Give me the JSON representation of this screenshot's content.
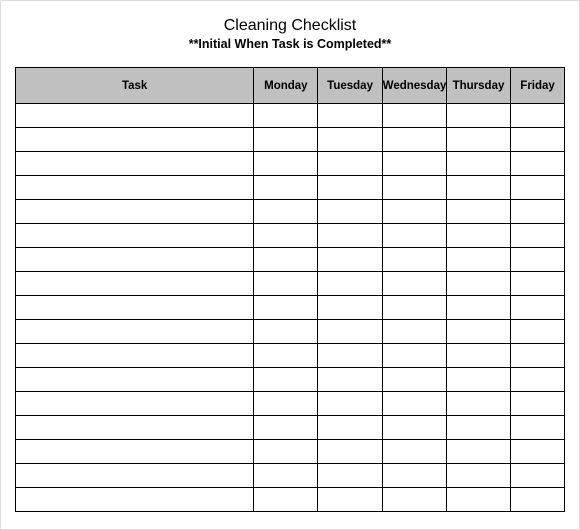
{
  "title": "Cleaning Checklist",
  "subtitle": "**Initial When Task is Completed**",
  "columns": {
    "task": "Task",
    "monday": "Monday",
    "tuesday": "Tuesday",
    "wednesday": "Wednesday",
    "thursday": "Thursday",
    "friday": "Friday"
  },
  "rows": [
    {
      "task": "",
      "monday": "",
      "tuesday": "",
      "wednesday": "",
      "thursday": "",
      "friday": ""
    },
    {
      "task": "",
      "monday": "",
      "tuesday": "",
      "wednesday": "",
      "thursday": "",
      "friday": ""
    },
    {
      "task": "",
      "monday": "",
      "tuesday": "",
      "wednesday": "",
      "thursday": "",
      "friday": ""
    },
    {
      "task": "",
      "monday": "",
      "tuesday": "",
      "wednesday": "",
      "thursday": "",
      "friday": ""
    },
    {
      "task": "",
      "monday": "",
      "tuesday": "",
      "wednesday": "",
      "thursday": "",
      "friday": ""
    },
    {
      "task": "",
      "monday": "",
      "tuesday": "",
      "wednesday": "",
      "thursday": "",
      "friday": ""
    },
    {
      "task": "",
      "monday": "",
      "tuesday": "",
      "wednesday": "",
      "thursday": "",
      "friday": ""
    },
    {
      "task": "",
      "monday": "",
      "tuesday": "",
      "wednesday": "",
      "thursday": "",
      "friday": ""
    },
    {
      "task": "",
      "monday": "",
      "tuesday": "",
      "wednesday": "",
      "thursday": "",
      "friday": ""
    },
    {
      "task": "",
      "monday": "",
      "tuesday": "",
      "wednesday": "",
      "thursday": "",
      "friday": ""
    },
    {
      "task": "",
      "monday": "",
      "tuesday": "",
      "wednesday": "",
      "thursday": "",
      "friday": ""
    },
    {
      "task": "",
      "monday": "",
      "tuesday": "",
      "wednesday": "",
      "thursday": "",
      "friday": ""
    },
    {
      "task": "",
      "monday": "",
      "tuesday": "",
      "wednesday": "",
      "thursday": "",
      "friday": ""
    },
    {
      "task": "",
      "monday": "",
      "tuesday": "",
      "wednesday": "",
      "thursday": "",
      "friday": ""
    },
    {
      "task": "",
      "monday": "",
      "tuesday": "",
      "wednesday": "",
      "thursday": "",
      "friday": ""
    },
    {
      "task": "",
      "monday": "",
      "tuesday": "",
      "wednesday": "",
      "thursday": "",
      "friday": ""
    },
    {
      "task": "",
      "monday": "",
      "tuesday": "",
      "wednesday": "",
      "thursday": "",
      "friday": ""
    }
  ]
}
